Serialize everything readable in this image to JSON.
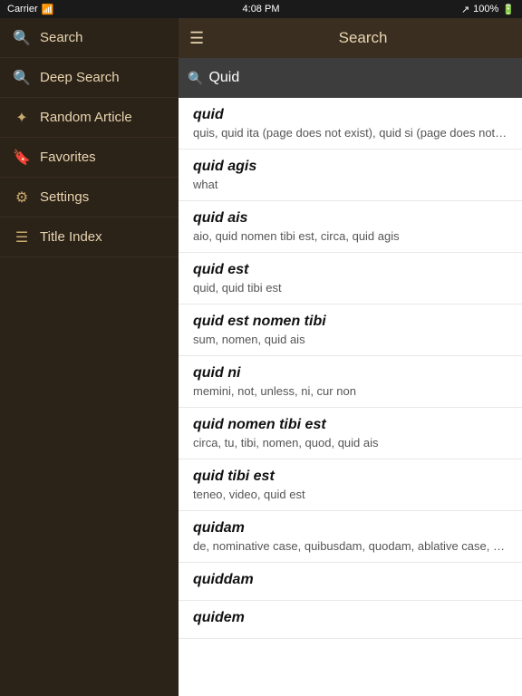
{
  "statusBar": {
    "carrier": "Carrier",
    "time": "4:08 PM",
    "signal": "100%"
  },
  "sidebar": {
    "items": [
      {
        "id": "search",
        "label": "Search",
        "icon": "🔍"
      },
      {
        "id": "deep-search",
        "label": "Deep Search",
        "icon": "🔍"
      },
      {
        "id": "random-article",
        "label": "Random Article",
        "icon": "✦"
      },
      {
        "id": "favorites",
        "label": "Favorites",
        "icon": "🔖"
      },
      {
        "id": "settings",
        "label": "Settings",
        "icon": "⚙"
      },
      {
        "id": "title-index",
        "label": "Title Index",
        "icon": "☰"
      }
    ]
  },
  "header": {
    "title": "Search",
    "hamburger": "☰"
  },
  "searchBar": {
    "value": "Quid",
    "placeholder": "Search"
  },
  "results": [
    {
      "title": "quid",
      "desc": "quis, quid ita (page does not exist), quid si (page does not exist), ca cosa (page does not exist), qui (p"
    },
    {
      "title": "quid agis",
      "desc": "what"
    },
    {
      "title": "quid ais",
      "desc": "aio, quid nomen tibi est, circa, quid agis"
    },
    {
      "title": "quid est",
      "desc": "quid, quid tibi est"
    },
    {
      "title": "quid est nomen tibi",
      "desc": "sum, nomen, quid ais"
    },
    {
      "title": "quid ni",
      "desc": "memini, not, unless, ni, cur non"
    },
    {
      "title": "quid nomen tibi est",
      "desc": "circa, tu, tibi, nomen, quod, quid ais"
    },
    {
      "title": "quid tibi est",
      "desc": "teneo, video, quid est"
    },
    {
      "title": "quidam",
      "desc": "de, nominative case, quibusdam, quodam, ablative case, quorundam, quaedam, dative case, cujusdar"
    },
    {
      "title": "quiddam",
      "desc": ""
    },
    {
      "title": "quidem",
      "desc": ""
    }
  ]
}
